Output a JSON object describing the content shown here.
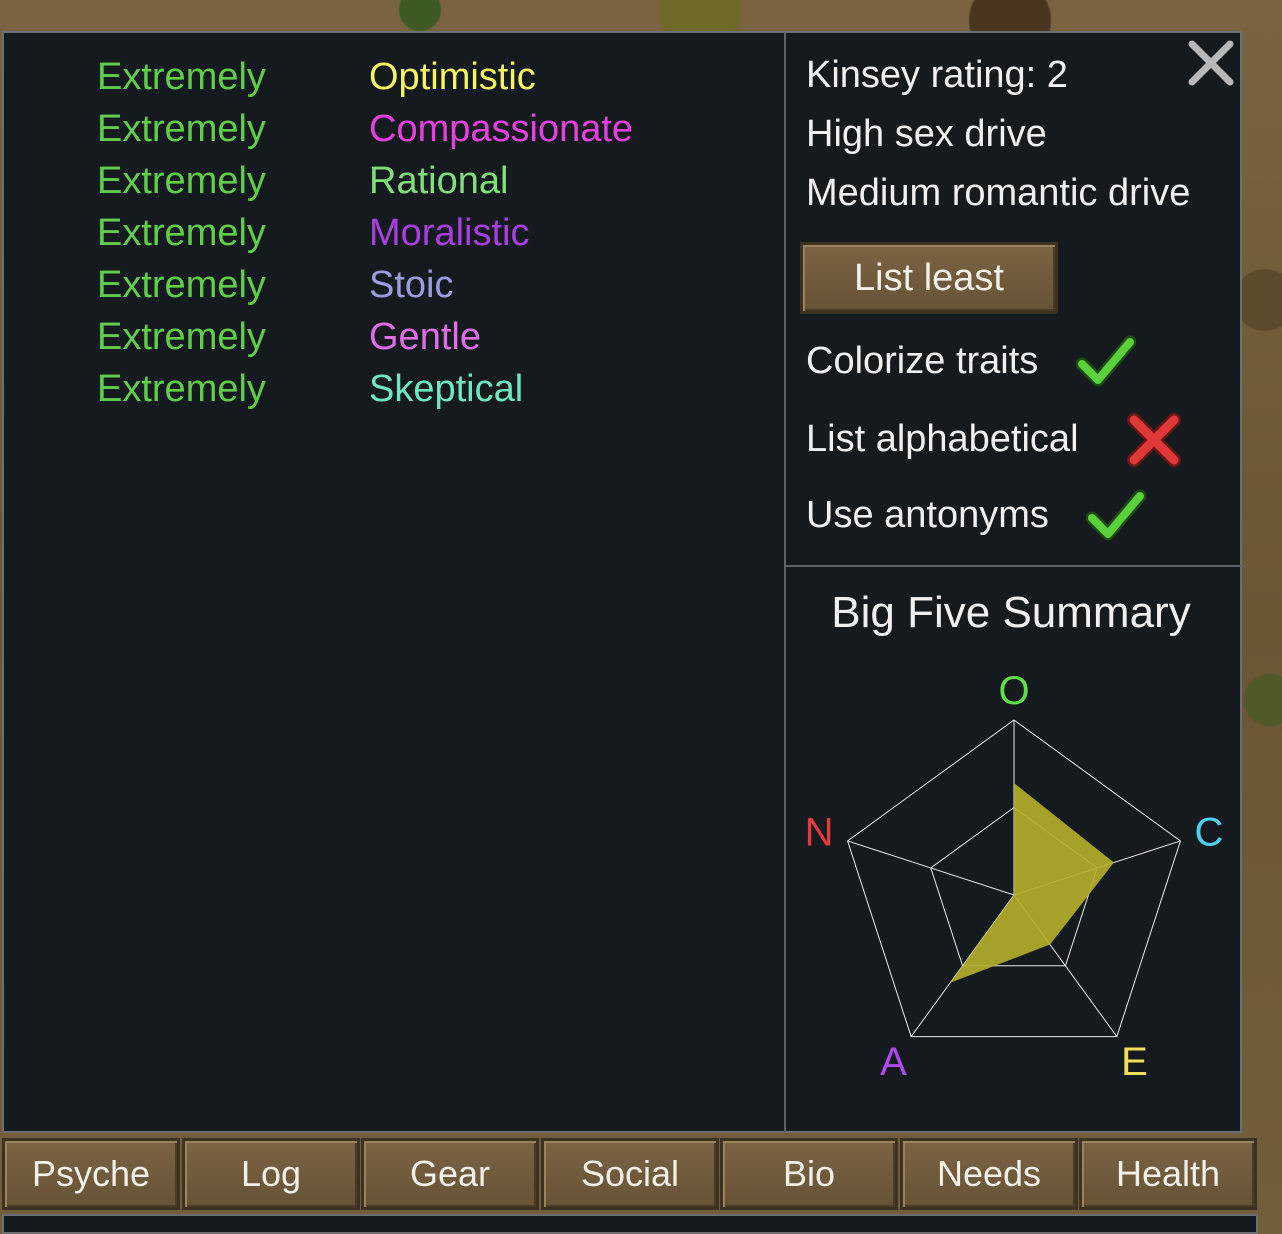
{
  "traits": [
    {
      "modifier": "Extremely",
      "name": "Optimistic",
      "color": "#f5f562"
    },
    {
      "modifier": "Extremely",
      "name": "Compassionate",
      "color": "#e83fe0"
    },
    {
      "modifier": "Extremely",
      "name": "Rational",
      "color": "#7fe07a"
    },
    {
      "modifier": "Extremely",
      "name": "Moralistic",
      "color": "#a93fe0"
    },
    {
      "modifier": "Extremely",
      "name": "Stoic",
      "color": "#9a9ee0"
    },
    {
      "modifier": "Extremely",
      "name": "Gentle",
      "color": "#e06ee8"
    },
    {
      "modifier": "Extremely",
      "name": "Skeptical",
      "color": "#6ee8c0"
    }
  ],
  "modifier_color": "#5fcf4a",
  "info": {
    "kinsey": "Kinsey rating: 2",
    "sex_drive": "High sex drive",
    "romantic_drive": "Medium romantic drive"
  },
  "list_button": "List least",
  "toggles": [
    {
      "label": "Colorize traits",
      "state": true
    },
    {
      "label": "List alphabetical",
      "state": false
    },
    {
      "label": "Use antonyms",
      "state": true
    }
  ],
  "big_five": {
    "title": "Big Five Summary",
    "axes": [
      {
        "letter": "O",
        "color": "#5fe04a",
        "value": 0.64
      },
      {
        "letter": "C",
        "color": "#4ad0f0",
        "value": 0.6
      },
      {
        "letter": "E",
        "color": "#f0e05a",
        "value": 0.35
      },
      {
        "letter": "A",
        "color": "#b04af0",
        "value": 0.62
      },
      {
        "letter": "N",
        "color": "#e03a3a",
        "value": 0
      }
    ],
    "fill_color": "#b5b02a"
  },
  "tabs": [
    "Psyche",
    "Log",
    "Gear",
    "Social",
    "Bio",
    "Needs",
    "Health"
  ]
}
